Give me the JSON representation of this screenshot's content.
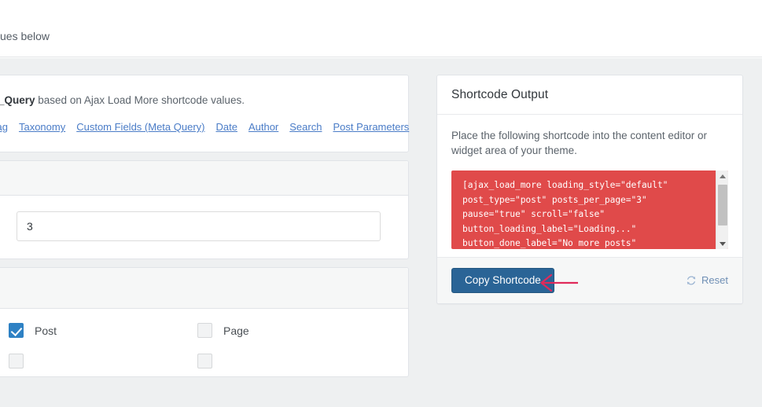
{
  "top_bar": {
    "truncated_text": "ues below"
  },
  "left_panel": {
    "description_bold": "P_Query",
    "description_rest": " based on Ajax Load More shortcode values.",
    "links": [
      {
        "label": "Tag"
      },
      {
        "label": "Taxonomy"
      },
      {
        "label": "Custom Fields (Meta Query)"
      },
      {
        "label": "Date"
      },
      {
        "label": "Author"
      },
      {
        "label": "Search"
      },
      {
        "label": "Post Parameters"
      }
    ],
    "posts_per_page": {
      "value": "3",
      "placeholder": ""
    },
    "post_types": [
      {
        "label": "Post",
        "checked": true
      },
      {
        "label": "Page",
        "checked": false
      }
    ]
  },
  "shortcode_card": {
    "title": "Shortcode Output",
    "description": "Place the following shortcode into the content editor or widget area of your theme.",
    "code": "[ajax_load_more loading_style=\"default\" post_type=\"post\" posts_per_page=\"3\" pause=\"true\" scroll=\"false\" button_loading_label=\"Loading...\" button_done_label=\"No more posts\" no_results_text=\"No results matched your",
    "code_background": "#e04a4a",
    "copy_button_label": "Copy Shortcode",
    "copy_button_color": "#2a6496",
    "reset_label": "Reset",
    "reset_icon": "refresh-icon",
    "scrollbar": {
      "up_icon": "caret-up-icon",
      "down_icon": "caret-down-icon"
    }
  },
  "annotation": {
    "arrow_icon": "left-arrow-annotation",
    "arrow_color": "#e02a5a"
  }
}
